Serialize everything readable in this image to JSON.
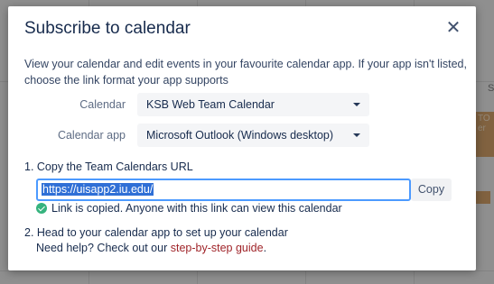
{
  "background": {
    "event_text_1": "TO",
    "event_text_2": "er",
    "col_header": "S"
  },
  "dialog": {
    "title": "Subscribe to calendar",
    "close_icon": "close-icon",
    "intro": "View your calendar and edit events in your favourite calendar app. If your app isn't listed, choose the link format your app supports",
    "calendar_label": "Calendar",
    "calendar_value": "KSB Web Team Calendar",
    "app_label": "Calendar app",
    "app_value": "Microsoft Outlook (Windows desktop)",
    "step1": "1. Copy the Team Calendars URL",
    "url_value": "https://uisapp2.iu.edu/",
    "copy_label": "Copy",
    "copied_message": "Link is copied. Anyone with this link can view this calendar",
    "step2": "2. Head to your calendar app to set up your calendar",
    "help_prefix": "Need help? Check out our ",
    "help_link": "step-by-step guide",
    "help_suffix": "."
  },
  "colors": {
    "accent": "#4c9aff",
    "success": "#36b37e",
    "link": "#a0252a"
  }
}
